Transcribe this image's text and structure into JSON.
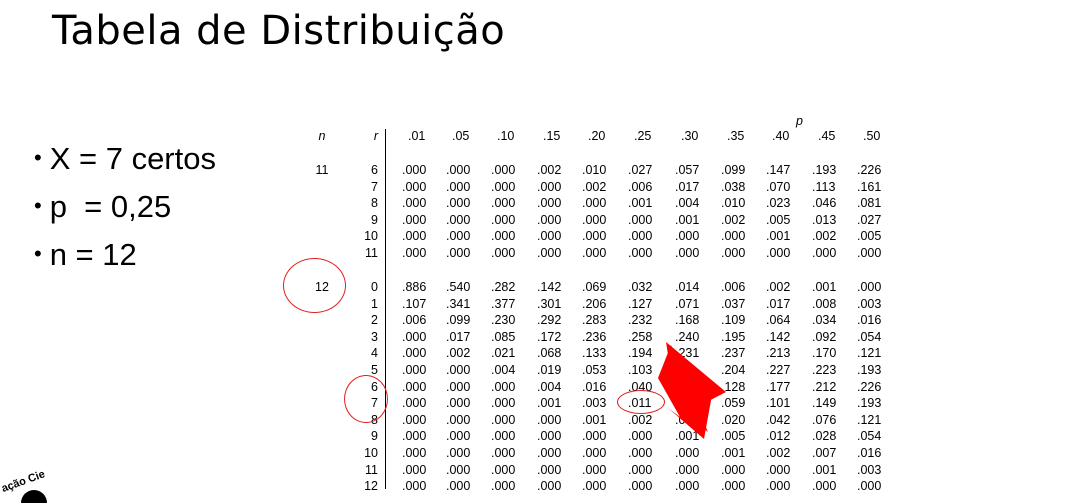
{
  "slide": {
    "title": "Tabela de Distribuição",
    "bullets": [
      "X = 7 certos",
      "p  = 0,25",
      "n = 12"
    ]
  },
  "table": {
    "n_header": "n",
    "r_header": "r",
    "p_header": "p",
    "p_values": [
      ".01",
      ".05",
      ".10",
      ".15",
      ".20",
      ".25",
      ".30",
      ".35",
      ".40",
      ".45",
      ".50"
    ],
    "groups": [
      {
        "n": "11",
        "rows": [
          {
            "r": "6",
            "vals": [
              ".000",
              ".000",
              ".000",
              ".002",
              ".010",
              ".027",
              ".057",
              ".099",
              ".147",
              ".193",
              ".226"
            ]
          },
          {
            "r": "7",
            "vals": [
              ".000",
              ".000",
              ".000",
              ".000",
              ".002",
              ".006",
              ".017",
              ".038",
              ".070",
              ".113",
              ".161"
            ]
          },
          {
            "r": "8",
            "vals": [
              ".000",
              ".000",
              ".000",
              ".000",
              ".000",
              ".001",
              ".004",
              ".010",
              ".023",
              ".046",
              ".081"
            ]
          },
          {
            "r": "9",
            "vals": [
              ".000",
              ".000",
              ".000",
              ".000",
              ".000",
              ".000",
              ".001",
              ".002",
              ".005",
              ".013",
              ".027"
            ]
          },
          {
            "r": "10",
            "vals": [
              ".000",
              ".000",
              ".000",
              ".000",
              ".000",
              ".000",
              ".000",
              ".000",
              ".001",
              ".002",
              ".005"
            ]
          },
          {
            "r": "11",
            "vals": [
              ".000",
              ".000",
              ".000",
              ".000",
              ".000",
              ".000",
              ".000",
              ".000",
              ".000",
              ".000",
              ".000"
            ]
          }
        ]
      },
      {
        "n": "12",
        "rows": [
          {
            "r": "0",
            "vals": [
              ".886",
              ".540",
              ".282",
              ".142",
              ".069",
              ".032",
              ".014",
              ".006",
              ".002",
              ".001",
              ".000"
            ]
          },
          {
            "r": "1",
            "vals": [
              ".107",
              ".341",
              ".377",
              ".301",
              ".206",
              ".127",
              ".071",
              ".037",
              ".017",
              ".008",
              ".003"
            ]
          },
          {
            "r": "2",
            "vals": [
              ".006",
              ".099",
              ".230",
              ".292",
              ".283",
              ".232",
              ".168",
              ".109",
              ".064",
              ".034",
              ".016"
            ]
          },
          {
            "r": "3",
            "vals": [
              ".000",
              ".017",
              ".085",
              ".172",
              ".236",
              ".258",
              ".240",
              ".195",
              ".142",
              ".092",
              ".054"
            ]
          },
          {
            "r": "4",
            "vals": [
              ".000",
              ".002",
              ".021",
              ".068",
              ".133",
              ".194",
              ".231",
              ".237",
              ".213",
              ".170",
              ".121"
            ]
          },
          {
            "r": "5",
            "vals": [
              ".000",
              ".000",
              ".004",
              ".019",
              ".053",
              ".103",
              "",
              ".204",
              ".227",
              ".223",
              ".193"
            ]
          },
          {
            "r": "6",
            "vals": [
              ".000",
              ".000",
              ".000",
              ".004",
              ".016",
              ".040",
              "",
              ".128",
              ".177",
              ".212",
              ".226"
            ]
          },
          {
            "r": "7",
            "vals": [
              ".000",
              ".000",
              ".000",
              ".001",
              ".003",
              ".011",
              "",
              ".059",
              ".101",
              ".149",
              ".193"
            ]
          },
          {
            "r": "8",
            "vals": [
              ".000",
              ".000",
              ".000",
              ".000",
              ".001",
              ".002",
              ".00",
              ".020",
              ".042",
              ".076",
              ".121"
            ]
          },
          {
            "r": "9",
            "vals": [
              ".000",
              ".000",
              ".000",
              ".000",
              ".000",
              ".000",
              ".001",
              ".005",
              ".012",
              ".028",
              ".054"
            ]
          },
          {
            "r": "10",
            "vals": [
              ".000",
              ".000",
              ".000",
              ".000",
              ".000",
              ".000",
              ".000",
              ".001",
              ".002",
              ".007",
              ".016"
            ]
          },
          {
            "r": "11",
            "vals": [
              ".000",
              ".000",
              ".000",
              ".000",
              ".000",
              ".000",
              ".000",
              ".000",
              ".000",
              ".001",
              ".003"
            ]
          },
          {
            "r": "12",
            "vals": [
              ".000",
              ".000",
              ".000",
              ".000",
              ".000",
              ".000",
              ".000",
              ".000",
              ".000",
              ".000",
              ".000"
            ]
          }
        ]
      }
    ]
  },
  "annotations": {
    "color": "#e02020",
    "highlighted_n": "12",
    "highlighted_r": "7",
    "highlighted_value": ".011"
  },
  "logo": {
    "text": "ação Cie"
  }
}
